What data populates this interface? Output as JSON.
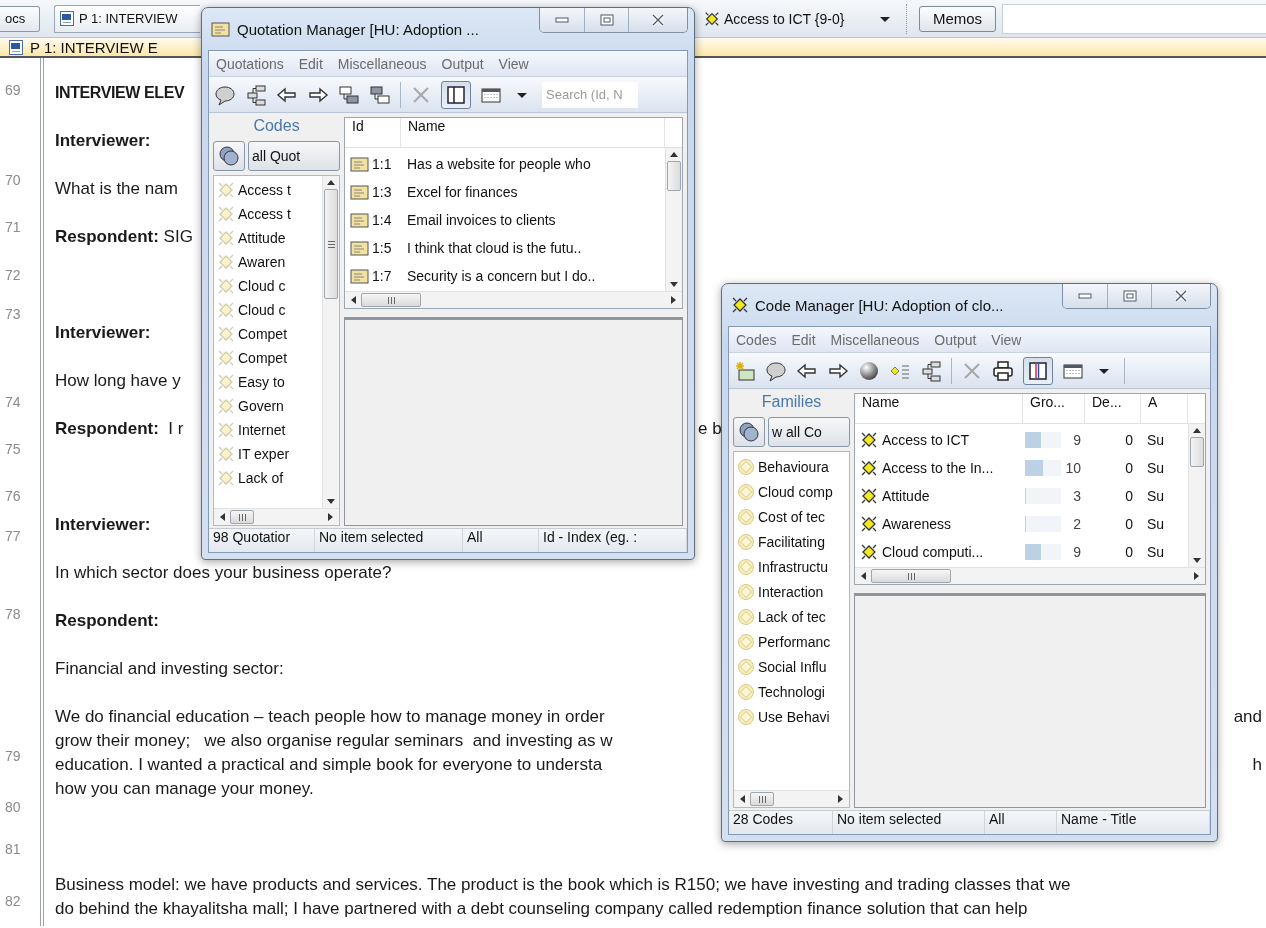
{
  "top_bar": {
    "docs_button": "ocs",
    "document_tab": "P 1: INTERVIEW",
    "code_selector": "Access to ICT {9-0}",
    "memos_button": "Memos"
  },
  "document": {
    "title": "P 1: INTERVIEW E",
    "line_numbers": [
      "69",
      "70",
      "71",
      "72",
      "73",
      "74",
      "75",
      "76",
      "77",
      "78",
      "79",
      "80",
      "81",
      "82"
    ],
    "lines": [
      {
        "kind": "heading",
        "text": "INTERVIEW ELEV"
      },
      {
        "kind": "bold",
        "text": "Interviewer:"
      },
      {
        "kind": "text",
        "text": "What is the nam"
      },
      {
        "kind": "text",
        "text": "**Respondent:** SIG"
      },
      {
        "kind": "blank"
      },
      {
        "kind": "bold",
        "text": "Interviewer:"
      },
      {
        "kind": "text",
        "text": "How long have y"
      },
      {
        "kind": "text",
        "text": "**Respondent:**  I r",
        "tail": {
          "text": "e b",
          "between_windows": true
        }
      },
      {
        "kind": "blank"
      },
      {
        "kind": "bold",
        "text": "Interviewer:"
      },
      {
        "kind": "text",
        "text": "In which sector does your business operate?"
      },
      {
        "kind": "bold",
        "text": "Respondent:"
      },
      {
        "kind": "text",
        "text": "Financial and investing sector:"
      },
      {
        "kind": "text",
        "text": "We do financial education – teach people how to manage money in order",
        "tail": {
          "text": "and",
          "between_windows": false
        }
      },
      {
        "kind": "line",
        "text": "grow their money;   we also organise regular seminars  and investing as w"
      },
      {
        "kind": "line",
        "text": "education. I wanted a practical and simple book for everyone to understa",
        "tail": {
          "text": "h",
          "between_windows": false
        }
      },
      {
        "kind": "line",
        "text": "how you can manage your money."
      },
      {
        "kind": "blank"
      },
      {
        "kind": "text",
        "text": "Business model: we have products and services. The product is the book which is R150; we have investing and trading classes that we"
      },
      {
        "kind": "line",
        "text": "do behind the khayalitsha mall; I have partnered with a debt counseling company called redemption finance solution that can help"
      }
    ]
  },
  "quotation_manager": {
    "title": "Quotation Manager [HU: Adoption ...",
    "menu": [
      "Quotations",
      "Edit",
      "Miscellaneous",
      "Output",
      "View"
    ],
    "panel_toggle_pressed": true,
    "search": {
      "placeholder": "Search (Id, N"
    },
    "codes_pane": {
      "heading": "Codes",
      "show_all_button": "all Quot",
      "codes": [
        "Access t",
        "Access t",
        "Attitude",
        "Awaren",
        "Cloud c",
        "Cloud c",
        "Compet",
        "Compet",
        "Easy to",
        "Govern",
        "Internet",
        "IT exper",
        "Lack of"
      ]
    },
    "table": {
      "columns": [
        "Id",
        "Name"
      ],
      "rows": [
        {
          "id": "1:1",
          "name": "Has a website for people who"
        },
        {
          "id": "1:3",
          "name": "Excel for finances"
        },
        {
          "id": "1:4",
          "name": "Email invoices to clients"
        },
        {
          "id": "1:5",
          "name": "I think that cloud is the futu.."
        },
        {
          "id": "1:7",
          "name": "Security is a concern but I do.."
        }
      ]
    },
    "status_bar": [
      "98 Quotatior",
      "No item selected",
      "All",
      "Id - Index (eg. :"
    ]
  },
  "code_manager": {
    "title": "Code Manager [HU: Adoption of clo...",
    "menu": [
      "Codes",
      "Edit",
      "Miscellaneous",
      "Output",
      "View"
    ],
    "panel_toggle_pressed": true,
    "families_pane": {
      "heading": "Families",
      "show_all_button": "w all Co",
      "families": [
        "Behavioura",
        "Cloud comp",
        "Cost of tec",
        "Facilitating",
        "Infrastructu",
        "Interaction",
        "Lack of tec",
        "Performanc",
        "Social Influ",
        "Technologi",
        "Use Behavi"
      ]
    },
    "table": {
      "columns": [
        "Name",
        "Gro...",
        "De...",
        "A"
      ],
      "rows": [
        {
          "name": "Access to ICT",
          "level": 0.45,
          "groundedness": "9",
          "density": "0",
          "column_4": "Su"
        },
        {
          "name": "Access to the In...",
          "level": 0.5,
          "groundedness": "10",
          "density": "0",
          "column_4": "Su"
        },
        {
          "name": "Attitude",
          "level": 0.04,
          "groundedness": "3",
          "density": "0",
          "column_4": "Su"
        },
        {
          "name": "Awareness",
          "level": 0.03,
          "groundedness": "2",
          "density": "0",
          "column_4": "Su"
        },
        {
          "name": "Cloud computi...",
          "level": 0.45,
          "groundedness": "9",
          "density": "0",
          "column_4": "Su"
        }
      ]
    },
    "status_bar": [
      "28 Codes",
      "No item selected",
      "All",
      "Name - Title"
    ]
  }
}
